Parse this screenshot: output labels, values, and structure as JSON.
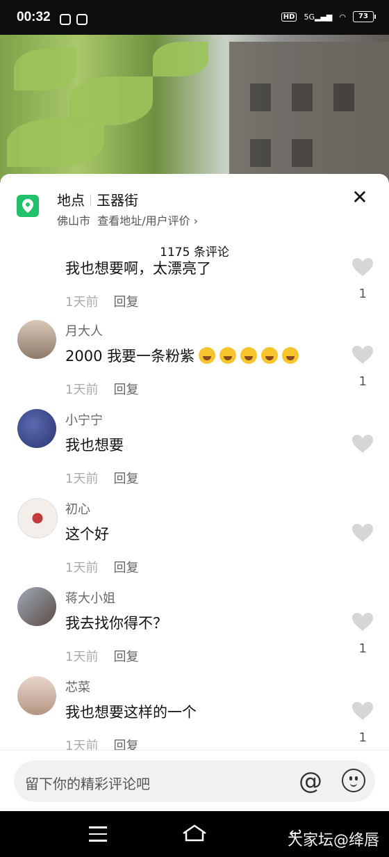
{
  "status_bar": {
    "time": "00:32",
    "hd": "HD",
    "network": "5G",
    "battery": "73"
  },
  "location": {
    "label": "地点",
    "name": "玉器街",
    "city": "佛山市",
    "link": "查看地址/用户评价 ›"
  },
  "comment_count": "1175 条评论",
  "comments": [
    {
      "user": "",
      "text": "我也想要啊，太漂亮了",
      "time": "1天前",
      "reply": "回复",
      "likes": "1"
    },
    {
      "user": "月大人",
      "text": "2000 我要一条粉紫",
      "time": "1天前",
      "reply": "回复",
      "likes": "1"
    },
    {
      "user": "小宁宁",
      "text": "我也想要",
      "time": "1天前",
      "reply": "回复",
      "likes": ""
    },
    {
      "user": "初心",
      "text": "这个好",
      "time": "1天前",
      "reply": "回复",
      "likes": ""
    },
    {
      "user": "蒋大小姐",
      "text": "我去找你得不？",
      "time": "1天前",
      "reply": "回复",
      "likes": "1"
    },
    {
      "user": "芯菜",
      "text": "我也想要这样的一个",
      "time": "1天前",
      "reply": "回复",
      "likes": "1"
    }
  ],
  "input": {
    "placeholder": "留下你的精彩评论吧",
    "at_symbol": "@"
  },
  "watermark": "大家坛@绛唇"
}
